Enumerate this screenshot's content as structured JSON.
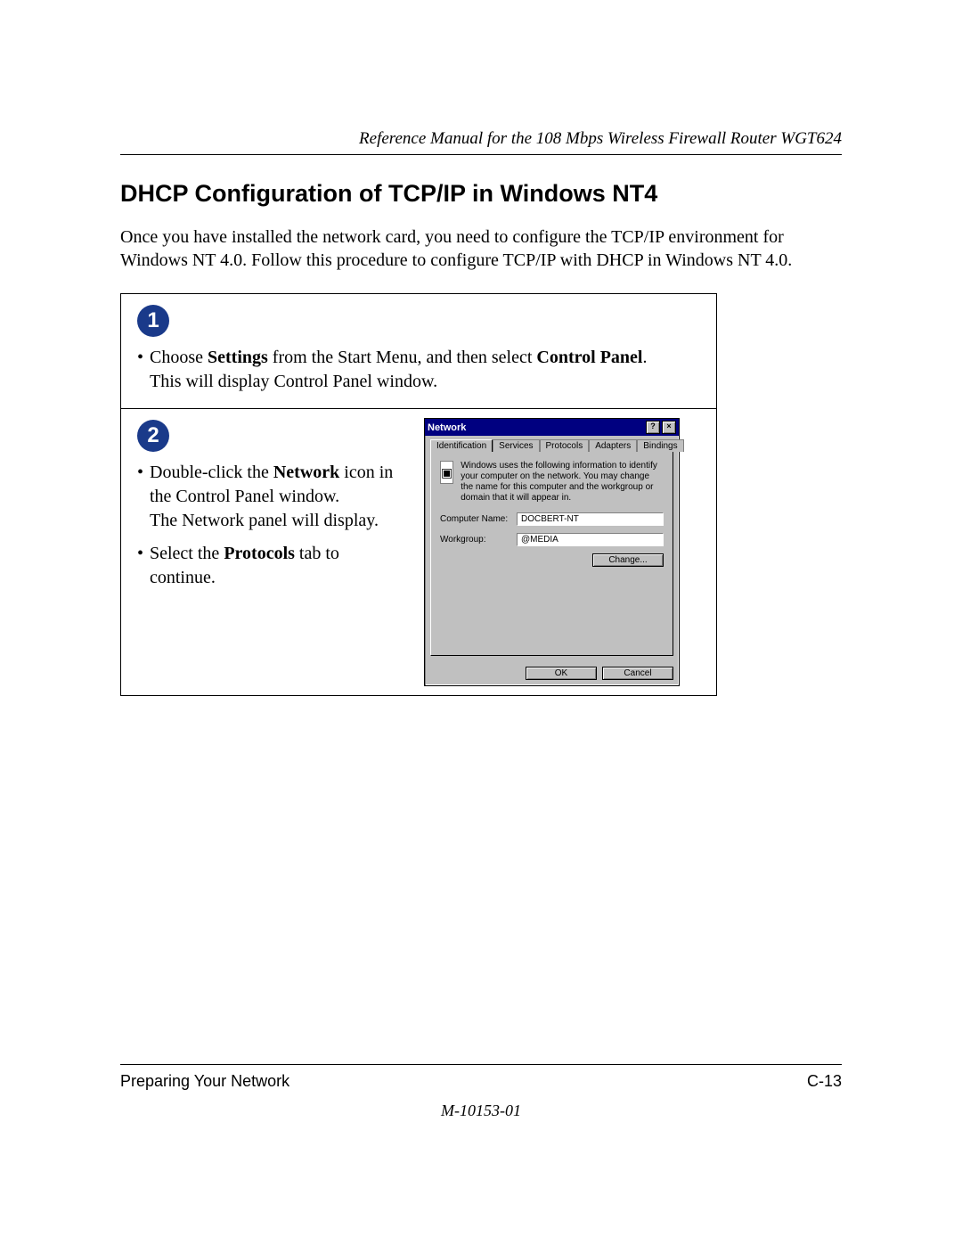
{
  "header": {
    "manual_title": "Reference Manual for the 108 Mbps Wireless Firewall Router WGT624"
  },
  "section": {
    "title": "DHCP Configuration of TCP/IP in Windows NT4",
    "intro": "Once you have installed the network card, you need to configure the TCP/IP environment for Windows NT 4.0. Follow this procedure to configure TCP/IP with DHCP in Windows NT 4.0."
  },
  "steps": [
    {
      "badge": "1",
      "lines": [
        {
          "bullet": "•",
          "pre": "Choose ",
          "bold1": "Settings",
          "mid": " from the Start Menu, and then select ",
          "bold2": "Control Panel",
          "post": "."
        },
        {
          "plain": "This will display Control Panel window."
        }
      ]
    },
    {
      "badge": "2",
      "lines": [
        {
          "bullet": "•",
          "pre": "Double-click the ",
          "bold1": "Network",
          "mid": " icon in the Control Panel window.",
          "bold2": "",
          "post": ""
        },
        {
          "plain": "The Network panel will display."
        },
        {
          "bullet": "•",
          "pre": "Select the ",
          "bold1": "Protocols",
          "mid": " tab to continue.",
          "bold2": "",
          "post": ""
        }
      ]
    }
  ],
  "dialog": {
    "title": "Network",
    "help_btn": "?",
    "close_btn": "×",
    "tabs": [
      "Identification",
      "Services",
      "Protocols",
      "Adapters",
      "Bindings"
    ],
    "active_tab": "Identification",
    "info_text": "Windows uses the following information to identify your computer on the network.  You may change the name for this computer and the workgroup or domain that it will appear in.",
    "fields": {
      "computer_name_label": "Computer Name:",
      "computer_name_value": "DOCBERT-NT",
      "workgroup_label": "Workgroup:",
      "workgroup_value": "@MEDIA"
    },
    "buttons": {
      "change": "Change...",
      "ok": "OK",
      "cancel": "Cancel"
    }
  },
  "footer": {
    "section_name": "Preparing Your Network",
    "page_num": "C-13",
    "doc_num": "M-10153-01"
  }
}
